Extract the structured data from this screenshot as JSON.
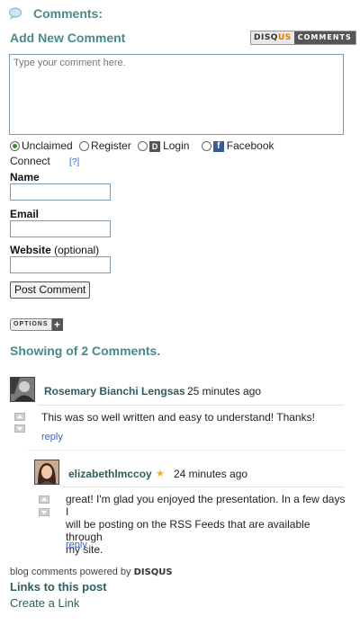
{
  "header": {
    "comments_title": "Comments:",
    "add_new_title": "Add New Comment",
    "badge_brand_a": "DISQ",
    "badge_brand_b": "US",
    "badge_comments": "COMMENTS",
    "icon": "speech-bubble-icon"
  },
  "form": {
    "comment_placeholder": "Type your comment here.",
    "radio_options": [
      {
        "label": "Unclaimed",
        "checked": true
      },
      {
        "label": "Register",
        "checked": false
      },
      {
        "label": "Login",
        "checked": false,
        "icon": "disqus-d-icon",
        "icon_text": "D"
      },
      {
        "label": "Facebook",
        "checked": false,
        "icon": "facebook-icon",
        "icon_text": "f"
      }
    ],
    "connect_label": "Connect",
    "help_link": "[?]",
    "name_label": "Name",
    "email_label": "Email",
    "website_label": "Website",
    "website_optional": "(optional)",
    "post_button": "Post Comment"
  },
  "options_label": "OPTIONS",
  "options_plus": "+",
  "showing_text": "Showing of 2 Comments.",
  "comments": [
    {
      "author": "Rosemary Bianchi Lengsas",
      "time": "25 minutes ago",
      "text": "This was so well written and easy to understand! Thanks!",
      "reply": "reply"
    },
    {
      "author": "elizabethlmccoy",
      "star": "★",
      "time": "24 minutes ago",
      "text_lines": [
        "great! I'm glad you enjoyed the presentation. In a few days I",
        "will be posting on the RSS Feeds that are available through",
        "my site."
      ],
      "reply": "reply"
    }
  ],
  "footer": {
    "powered_by": "blog comments powered by",
    "powered_brand": "DISQUS",
    "links_title": "Links to this post",
    "create_link": "Create a Link"
  },
  "colors": {
    "accent_teal": "#4a8a8a",
    "link_blue": "#3366cc",
    "facebook_blue": "#3b5998"
  }
}
